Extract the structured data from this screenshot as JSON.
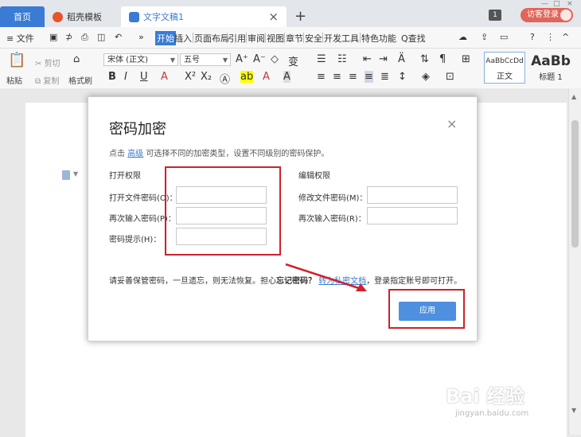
{
  "tabs": {
    "home": "首页",
    "template": "稻壳模板",
    "document": "文字文稿1",
    "close": "×",
    "add": "+"
  },
  "topright": {
    "window_count": "1",
    "login": "访客登录"
  },
  "menu": {
    "file": "≡ 文件",
    "more": "»",
    "items": [
      "开始",
      "插入",
      "页面布局",
      "引用",
      "审阅",
      "视图",
      "章节",
      "安全",
      "开发工具",
      "特色功能"
    ],
    "search": "Q查找",
    "help": "?",
    "collapse": "^"
  },
  "ribbon": {
    "paste": "粘贴",
    "cut": "剪切",
    "copy": "复制",
    "format_painter": "格式刷",
    "font_name": "宋体 (正文)",
    "font_size": "五号",
    "style_normal_preview": "AaBbCcDd",
    "style_normal": "正文",
    "style_h1_preview": "AaBb",
    "style_h1": "标题 1"
  },
  "dialog": {
    "title": "密码加密",
    "close": "×",
    "desc_prefix": "点击",
    "desc_link": "高级",
    "desc_suffix": "可选择不同的加密类型，设置不同级别的密码保护。",
    "open_section": "打开权限",
    "edit_section": "编辑权限",
    "open_password_label": "打开文件密码(O)：",
    "open_confirm_label": "再次输入密码(P)：",
    "hint_label": "密码提示(H)：",
    "edit_password_label": "修改文件密码(M)：",
    "edit_confirm_label": "再次输入密码(R)：",
    "warn_prefix": "请妥善保管密码，一旦遗忘，则无法恢复。担心",
    "warn_bold": "忘记密码？",
    "warn_link": "转为私密文档",
    "warn_suffix": "，登录指定账号即可打开。",
    "apply": "应用"
  },
  "watermark": {
    "main": "Bai 经验",
    "sub": "jingyan.baidu.com"
  },
  "colors": {
    "accent": "#3a7bd5",
    "highlight": "#d0202a",
    "login": "#e0655a"
  }
}
